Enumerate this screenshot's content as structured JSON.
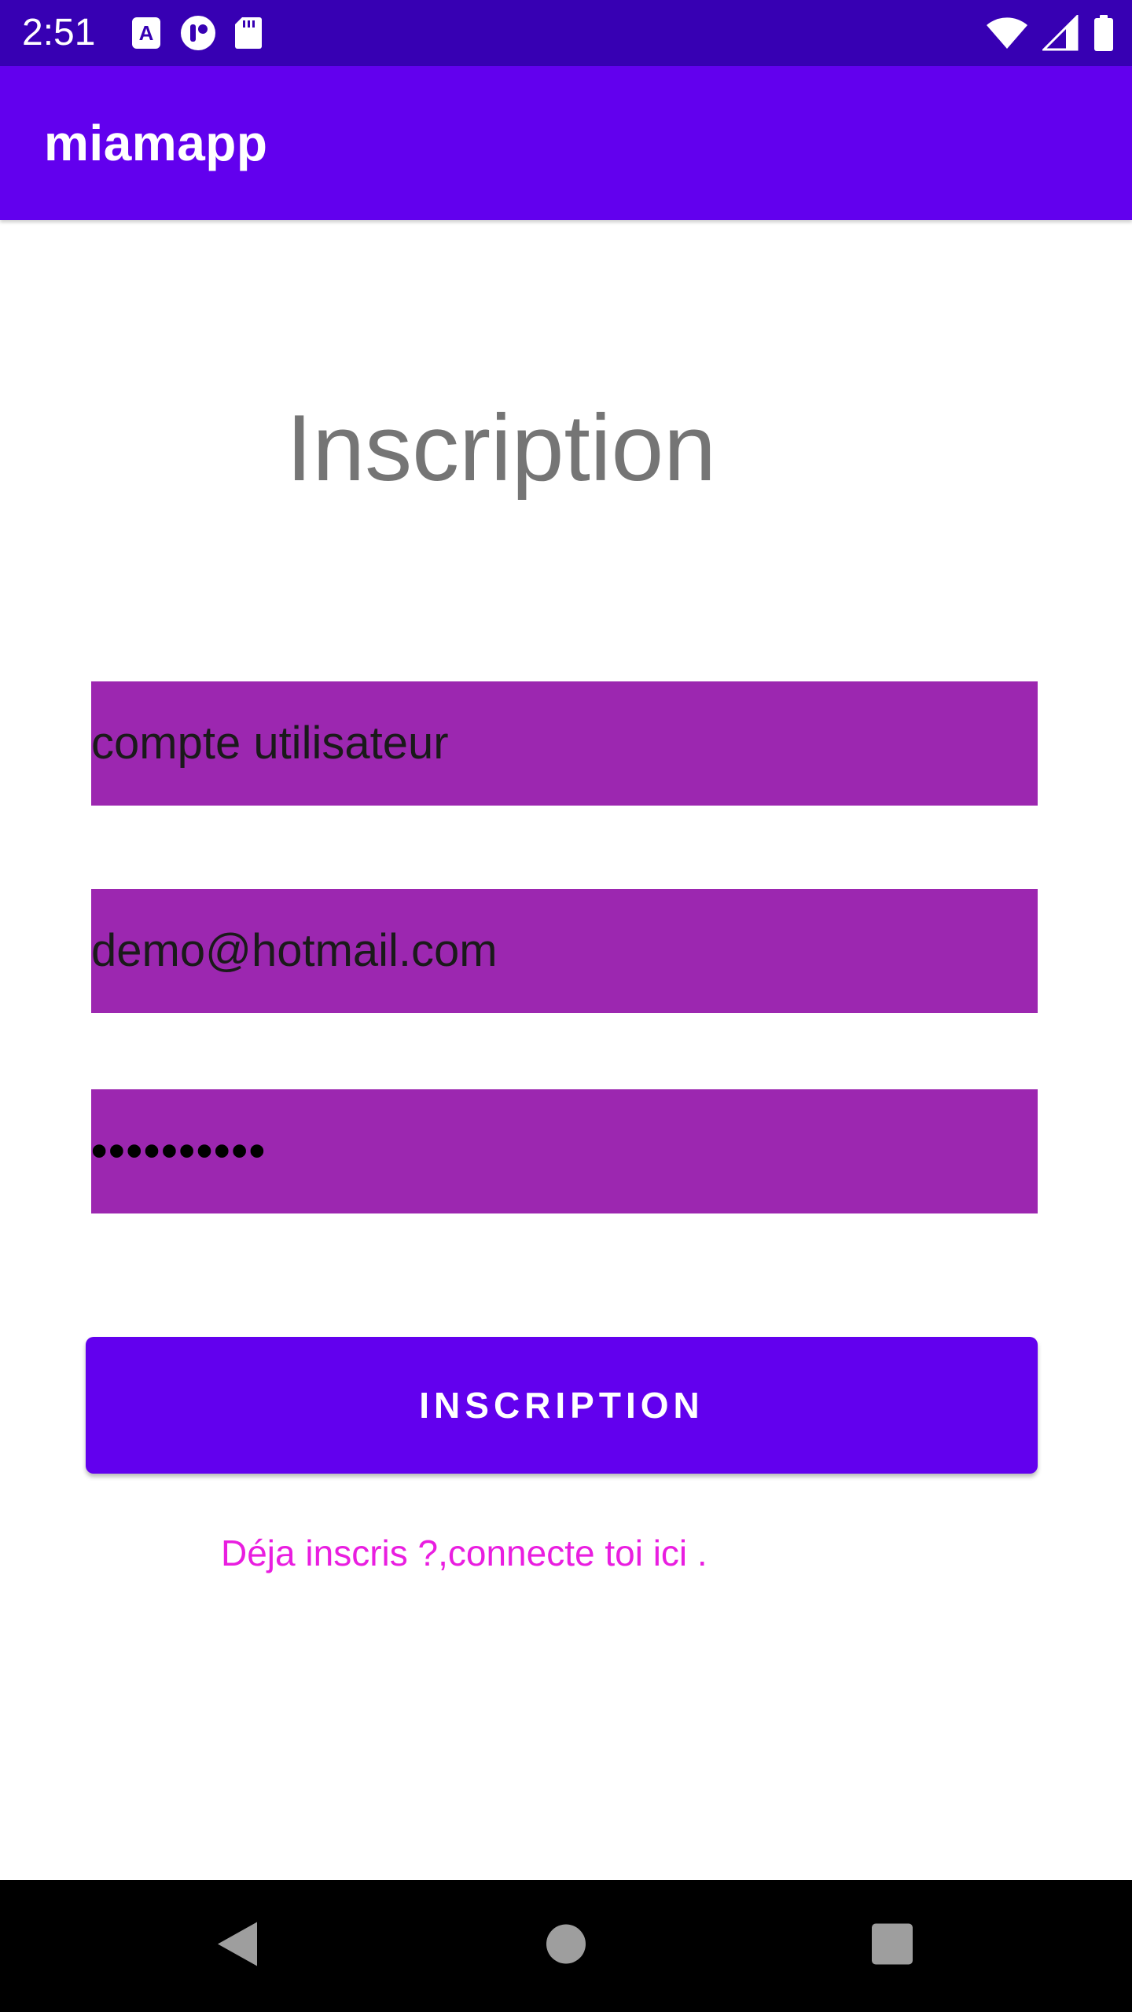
{
  "status_bar": {
    "time": "2:51",
    "left_icons": [
      "a-notification-icon",
      "app-notification-icon",
      "sd-card-icon"
    ],
    "right_icons": [
      "wifi-icon",
      "cell-signal-icon",
      "battery-icon"
    ]
  },
  "app_bar": {
    "title": "miamapp"
  },
  "page": {
    "title": "Inscription"
  },
  "form": {
    "username_value": "compte utilisateur",
    "email_value": "demo@hotmail.com",
    "password_mask": "••••••••••",
    "submit_label": "INSCRIPTION",
    "login_link": "Déja inscris ?,connecte toi ici ."
  },
  "nav_bar": {
    "buttons": [
      "back-icon",
      "home-icon",
      "recents-icon"
    ]
  },
  "colors": {
    "status_bar": "#3700b3",
    "primary": "#6200ee",
    "field_background": "#9c27b0",
    "title_gray": "#757575",
    "link": "#e91ee0"
  }
}
